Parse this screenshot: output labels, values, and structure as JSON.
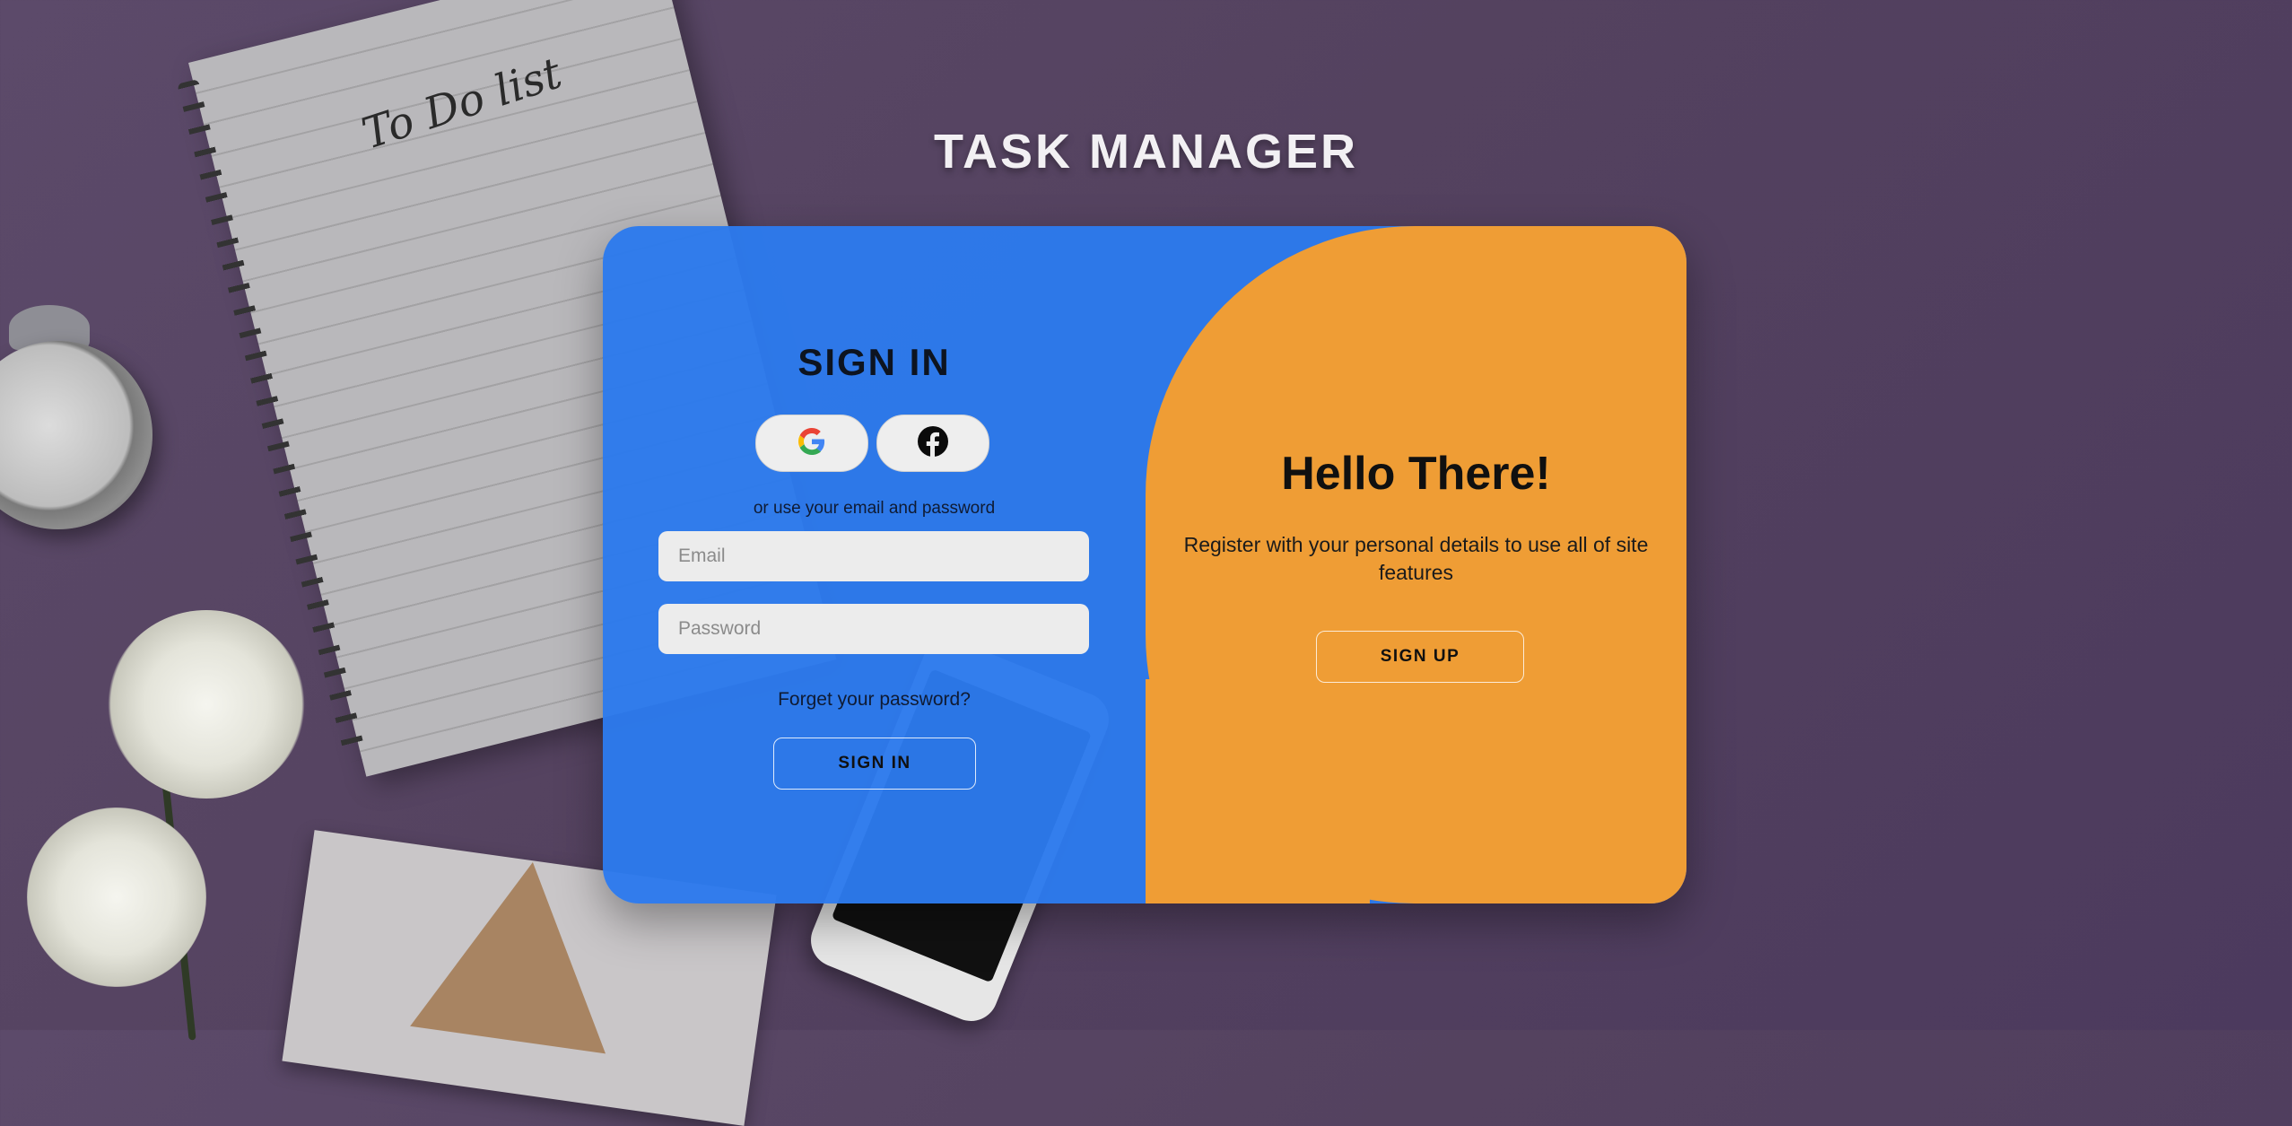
{
  "app": {
    "title": "TASK MANAGER"
  },
  "background": {
    "notebook_text": "To Do list"
  },
  "sign_in": {
    "title": "SIGN IN",
    "social": [
      {
        "name": "google",
        "icon": "google-icon"
      },
      {
        "name": "facebook",
        "icon": "facebook-icon"
      }
    ],
    "alt_text": "or use your email and password",
    "email": {
      "placeholder": "Email",
      "value": ""
    },
    "password": {
      "placeholder": "Password",
      "value": ""
    },
    "forgot_label": "Forget your password?",
    "button_label": "SIGN IN"
  },
  "sign_up": {
    "title": "Hello There!",
    "text": "Register with your personal details to use all of site features",
    "button_label": "SIGN UP"
  },
  "colors": {
    "left_panel": "#2c7aec",
    "right_panel": "#ef9d35",
    "background": "#54425f"
  }
}
